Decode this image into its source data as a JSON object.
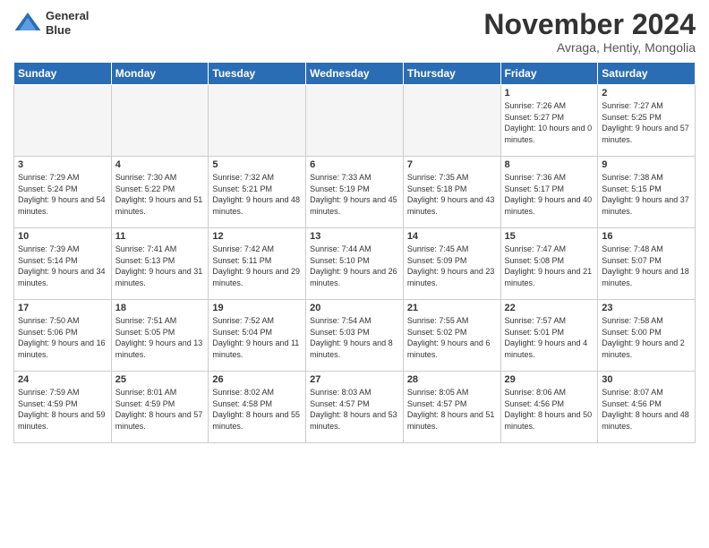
{
  "header": {
    "logo_line1": "General",
    "logo_line2": "Blue",
    "month": "November 2024",
    "location": "Avraga, Hentiy, Mongolia"
  },
  "weekdays": [
    "Sunday",
    "Monday",
    "Tuesday",
    "Wednesday",
    "Thursday",
    "Friday",
    "Saturday"
  ],
  "weeks": [
    [
      {
        "day": "",
        "empty": true
      },
      {
        "day": "",
        "empty": true
      },
      {
        "day": "",
        "empty": true
      },
      {
        "day": "",
        "empty": true
      },
      {
        "day": "",
        "empty": true
      },
      {
        "day": "1",
        "sunrise": "7:26 AM",
        "sunset": "5:27 PM",
        "daylight": "10 hours and 0 minutes."
      },
      {
        "day": "2",
        "sunrise": "7:27 AM",
        "sunset": "5:25 PM",
        "daylight": "9 hours and 57 minutes."
      }
    ],
    [
      {
        "day": "3",
        "sunrise": "7:29 AM",
        "sunset": "5:24 PM",
        "daylight": "9 hours and 54 minutes."
      },
      {
        "day": "4",
        "sunrise": "7:30 AM",
        "sunset": "5:22 PM",
        "daylight": "9 hours and 51 minutes."
      },
      {
        "day": "5",
        "sunrise": "7:32 AM",
        "sunset": "5:21 PM",
        "daylight": "9 hours and 48 minutes."
      },
      {
        "day": "6",
        "sunrise": "7:33 AM",
        "sunset": "5:19 PM",
        "daylight": "9 hours and 45 minutes."
      },
      {
        "day": "7",
        "sunrise": "7:35 AM",
        "sunset": "5:18 PM",
        "daylight": "9 hours and 43 minutes."
      },
      {
        "day": "8",
        "sunrise": "7:36 AM",
        "sunset": "5:17 PM",
        "daylight": "9 hours and 40 minutes."
      },
      {
        "day": "9",
        "sunrise": "7:38 AM",
        "sunset": "5:15 PM",
        "daylight": "9 hours and 37 minutes."
      }
    ],
    [
      {
        "day": "10",
        "sunrise": "7:39 AM",
        "sunset": "5:14 PM",
        "daylight": "9 hours and 34 minutes."
      },
      {
        "day": "11",
        "sunrise": "7:41 AM",
        "sunset": "5:13 PM",
        "daylight": "9 hours and 31 minutes."
      },
      {
        "day": "12",
        "sunrise": "7:42 AM",
        "sunset": "5:11 PM",
        "daylight": "9 hours and 29 minutes."
      },
      {
        "day": "13",
        "sunrise": "7:44 AM",
        "sunset": "5:10 PM",
        "daylight": "9 hours and 26 minutes."
      },
      {
        "day": "14",
        "sunrise": "7:45 AM",
        "sunset": "5:09 PM",
        "daylight": "9 hours and 23 minutes."
      },
      {
        "day": "15",
        "sunrise": "7:47 AM",
        "sunset": "5:08 PM",
        "daylight": "9 hours and 21 minutes."
      },
      {
        "day": "16",
        "sunrise": "7:48 AM",
        "sunset": "5:07 PM",
        "daylight": "9 hours and 18 minutes."
      }
    ],
    [
      {
        "day": "17",
        "sunrise": "7:50 AM",
        "sunset": "5:06 PM",
        "daylight": "9 hours and 16 minutes."
      },
      {
        "day": "18",
        "sunrise": "7:51 AM",
        "sunset": "5:05 PM",
        "daylight": "9 hours and 13 minutes."
      },
      {
        "day": "19",
        "sunrise": "7:52 AM",
        "sunset": "5:04 PM",
        "daylight": "9 hours and 11 minutes."
      },
      {
        "day": "20",
        "sunrise": "7:54 AM",
        "sunset": "5:03 PM",
        "daylight": "9 hours and 8 minutes."
      },
      {
        "day": "21",
        "sunrise": "7:55 AM",
        "sunset": "5:02 PM",
        "daylight": "9 hours and 6 minutes."
      },
      {
        "day": "22",
        "sunrise": "7:57 AM",
        "sunset": "5:01 PM",
        "daylight": "9 hours and 4 minutes."
      },
      {
        "day": "23",
        "sunrise": "7:58 AM",
        "sunset": "5:00 PM",
        "daylight": "9 hours and 2 minutes."
      }
    ],
    [
      {
        "day": "24",
        "sunrise": "7:59 AM",
        "sunset": "4:59 PM",
        "daylight": "8 hours and 59 minutes."
      },
      {
        "day": "25",
        "sunrise": "8:01 AM",
        "sunset": "4:59 PM",
        "daylight": "8 hours and 57 minutes."
      },
      {
        "day": "26",
        "sunrise": "8:02 AM",
        "sunset": "4:58 PM",
        "daylight": "8 hours and 55 minutes."
      },
      {
        "day": "27",
        "sunrise": "8:03 AM",
        "sunset": "4:57 PM",
        "daylight": "8 hours and 53 minutes."
      },
      {
        "day": "28",
        "sunrise": "8:05 AM",
        "sunset": "4:57 PM",
        "daylight": "8 hours and 51 minutes."
      },
      {
        "day": "29",
        "sunrise": "8:06 AM",
        "sunset": "4:56 PM",
        "daylight": "8 hours and 50 minutes."
      },
      {
        "day": "30",
        "sunrise": "8:07 AM",
        "sunset": "4:56 PM",
        "daylight": "8 hours and 48 minutes."
      }
    ]
  ]
}
